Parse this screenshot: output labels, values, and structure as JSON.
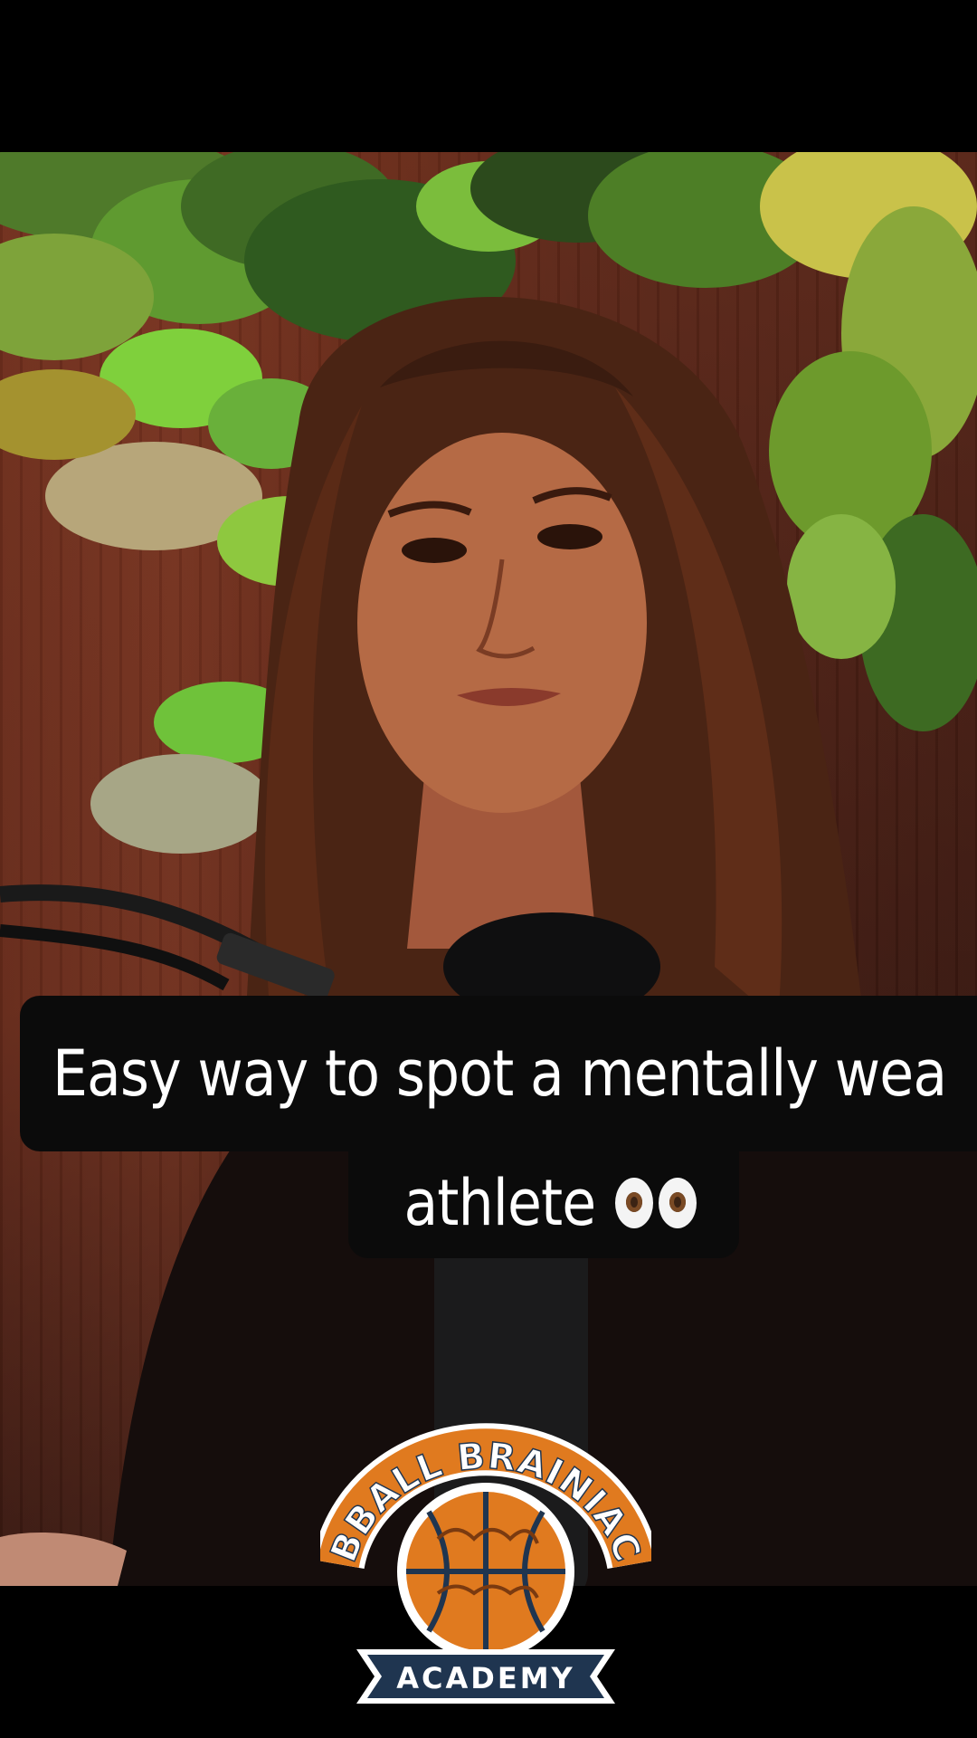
{
  "caption": {
    "line1": "Easy way to spot a mentally wea",
    "line2": "athlete",
    "emoji": "eyes-emoji"
  },
  "logo": {
    "top_text": "BBALL BRAINIAC",
    "bottom_text": "ACADEMY"
  },
  "colors": {
    "caption_bg": "#0b0b0b",
    "caption_text": "#ffffff",
    "logo_orange": "#e07a1f",
    "logo_navy": "#1f3550"
  }
}
